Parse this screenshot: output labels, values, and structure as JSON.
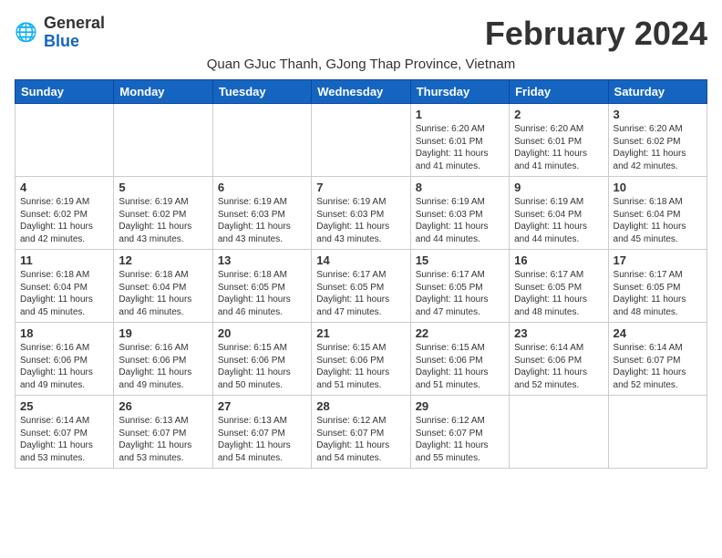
{
  "logo": {
    "general": "General",
    "blue": "Blue"
  },
  "title": "February 2024",
  "subtitle": "Quan GJuc Thanh, GJong Thap Province, Vietnam",
  "headers": [
    "Sunday",
    "Monday",
    "Tuesday",
    "Wednesday",
    "Thursday",
    "Friday",
    "Saturday"
  ],
  "weeks": [
    [
      {
        "day": "",
        "info": ""
      },
      {
        "day": "",
        "info": ""
      },
      {
        "day": "",
        "info": ""
      },
      {
        "day": "",
        "info": ""
      },
      {
        "day": "1",
        "info": "Sunrise: 6:20 AM\nSunset: 6:01 PM\nDaylight: 11 hours\nand 41 minutes."
      },
      {
        "day": "2",
        "info": "Sunrise: 6:20 AM\nSunset: 6:01 PM\nDaylight: 11 hours\nand 41 minutes."
      },
      {
        "day": "3",
        "info": "Sunrise: 6:20 AM\nSunset: 6:02 PM\nDaylight: 11 hours\nand 42 minutes."
      }
    ],
    [
      {
        "day": "4",
        "info": "Sunrise: 6:19 AM\nSunset: 6:02 PM\nDaylight: 11 hours\nand 42 minutes."
      },
      {
        "day": "5",
        "info": "Sunrise: 6:19 AM\nSunset: 6:02 PM\nDaylight: 11 hours\nand 43 minutes."
      },
      {
        "day": "6",
        "info": "Sunrise: 6:19 AM\nSunset: 6:03 PM\nDaylight: 11 hours\nand 43 minutes."
      },
      {
        "day": "7",
        "info": "Sunrise: 6:19 AM\nSunset: 6:03 PM\nDaylight: 11 hours\nand 43 minutes."
      },
      {
        "day": "8",
        "info": "Sunrise: 6:19 AM\nSunset: 6:03 PM\nDaylight: 11 hours\nand 44 minutes."
      },
      {
        "day": "9",
        "info": "Sunrise: 6:19 AM\nSunset: 6:04 PM\nDaylight: 11 hours\nand 44 minutes."
      },
      {
        "day": "10",
        "info": "Sunrise: 6:18 AM\nSunset: 6:04 PM\nDaylight: 11 hours\nand 45 minutes."
      }
    ],
    [
      {
        "day": "11",
        "info": "Sunrise: 6:18 AM\nSunset: 6:04 PM\nDaylight: 11 hours\nand 45 minutes."
      },
      {
        "day": "12",
        "info": "Sunrise: 6:18 AM\nSunset: 6:04 PM\nDaylight: 11 hours\nand 46 minutes."
      },
      {
        "day": "13",
        "info": "Sunrise: 6:18 AM\nSunset: 6:05 PM\nDaylight: 11 hours\nand 46 minutes."
      },
      {
        "day": "14",
        "info": "Sunrise: 6:17 AM\nSunset: 6:05 PM\nDaylight: 11 hours\nand 47 minutes."
      },
      {
        "day": "15",
        "info": "Sunrise: 6:17 AM\nSunset: 6:05 PM\nDaylight: 11 hours\nand 47 minutes."
      },
      {
        "day": "16",
        "info": "Sunrise: 6:17 AM\nSunset: 6:05 PM\nDaylight: 11 hours\nand 48 minutes."
      },
      {
        "day": "17",
        "info": "Sunrise: 6:17 AM\nSunset: 6:05 PM\nDaylight: 11 hours\nand 48 minutes."
      }
    ],
    [
      {
        "day": "18",
        "info": "Sunrise: 6:16 AM\nSunset: 6:06 PM\nDaylight: 11 hours\nand 49 minutes."
      },
      {
        "day": "19",
        "info": "Sunrise: 6:16 AM\nSunset: 6:06 PM\nDaylight: 11 hours\nand 49 minutes."
      },
      {
        "day": "20",
        "info": "Sunrise: 6:15 AM\nSunset: 6:06 PM\nDaylight: 11 hours\nand 50 minutes."
      },
      {
        "day": "21",
        "info": "Sunrise: 6:15 AM\nSunset: 6:06 PM\nDaylight: 11 hours\nand 51 minutes."
      },
      {
        "day": "22",
        "info": "Sunrise: 6:15 AM\nSunset: 6:06 PM\nDaylight: 11 hours\nand 51 minutes."
      },
      {
        "day": "23",
        "info": "Sunrise: 6:14 AM\nSunset: 6:06 PM\nDaylight: 11 hours\nand 52 minutes."
      },
      {
        "day": "24",
        "info": "Sunrise: 6:14 AM\nSunset: 6:07 PM\nDaylight: 11 hours\nand 52 minutes."
      }
    ],
    [
      {
        "day": "25",
        "info": "Sunrise: 6:14 AM\nSunset: 6:07 PM\nDaylight: 11 hours\nand 53 minutes."
      },
      {
        "day": "26",
        "info": "Sunrise: 6:13 AM\nSunset: 6:07 PM\nDaylight: 11 hours\nand 53 minutes."
      },
      {
        "day": "27",
        "info": "Sunrise: 6:13 AM\nSunset: 6:07 PM\nDaylight: 11 hours\nand 54 minutes."
      },
      {
        "day": "28",
        "info": "Sunrise: 6:12 AM\nSunset: 6:07 PM\nDaylight: 11 hours\nand 54 minutes."
      },
      {
        "day": "29",
        "info": "Sunrise: 6:12 AM\nSunset: 6:07 PM\nDaylight: 11 hours\nand 55 minutes."
      },
      {
        "day": "",
        "info": ""
      },
      {
        "day": "",
        "info": ""
      }
    ]
  ]
}
